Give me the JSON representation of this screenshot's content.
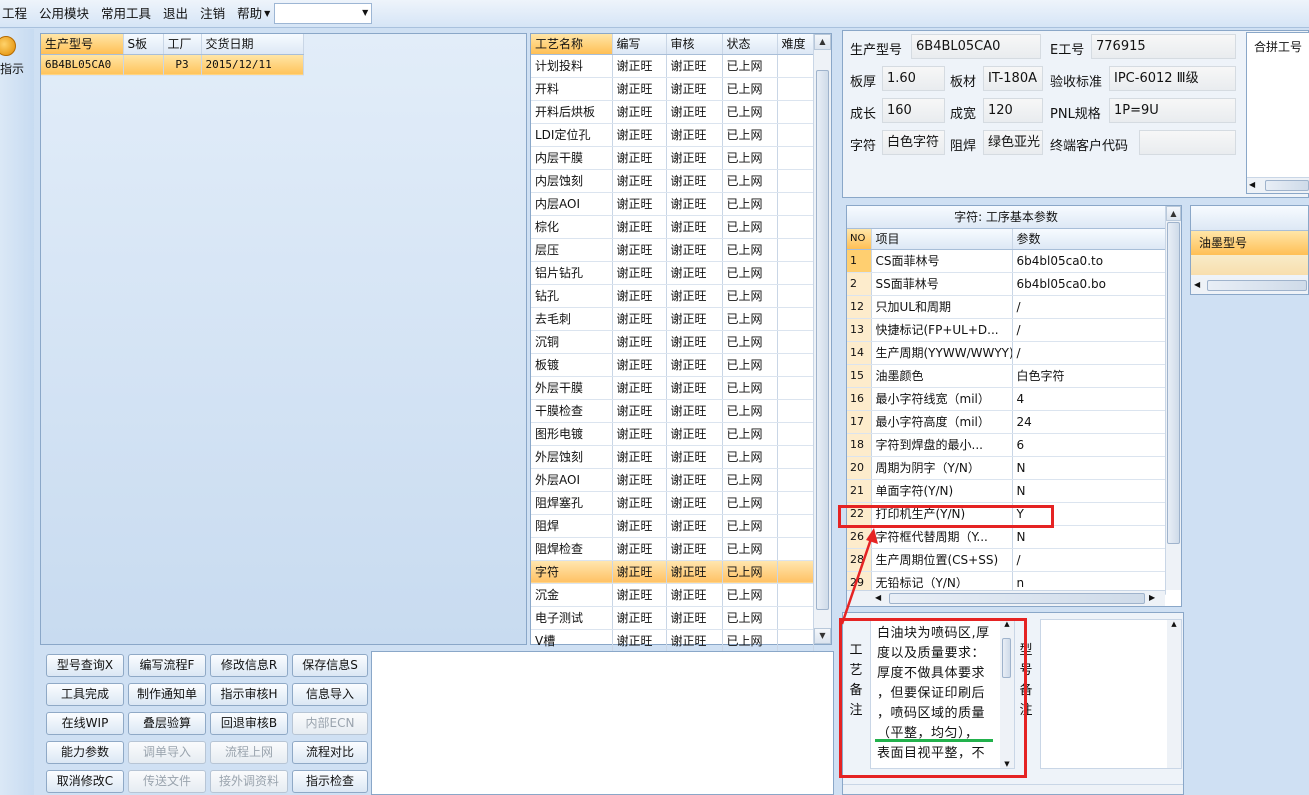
{
  "menu": {
    "items": [
      "工程",
      "公用模块",
      "常用工具",
      "退出",
      "注销",
      "帮助"
    ],
    "combo_value": ""
  },
  "side": {
    "label": "指示"
  },
  "orders": {
    "headers": [
      "生产型号",
      "S板",
      "工厂",
      "交货日期"
    ],
    "rows": [
      [
        "6B4BL05CA0",
        "",
        "P3",
        "2015/12/11"
      ]
    ]
  },
  "process": {
    "headers": [
      "工艺名称",
      "编写",
      "审核",
      "状态",
      "难度"
    ],
    "rows": [
      [
        "计划投料",
        "谢正旺",
        "谢正旺",
        "已上网",
        ""
      ],
      [
        "开料",
        "谢正旺",
        "谢正旺",
        "已上网",
        ""
      ],
      [
        "开料后烘板",
        "谢正旺",
        "谢正旺",
        "已上网",
        ""
      ],
      [
        "LDI定位孔",
        "谢正旺",
        "谢正旺",
        "已上网",
        ""
      ],
      [
        "内层干膜",
        "谢正旺",
        "谢正旺",
        "已上网",
        ""
      ],
      [
        "内层蚀刻",
        "谢正旺",
        "谢正旺",
        "已上网",
        ""
      ],
      [
        "内层AOI",
        "谢正旺",
        "谢正旺",
        "已上网",
        ""
      ],
      [
        "棕化",
        "谢正旺",
        "谢正旺",
        "已上网",
        ""
      ],
      [
        "层压",
        "谢正旺",
        "谢正旺",
        "已上网",
        ""
      ],
      [
        "铝片钻孔",
        "谢正旺",
        "谢正旺",
        "已上网",
        ""
      ],
      [
        "钻孔",
        "谢正旺",
        "谢正旺",
        "已上网",
        ""
      ],
      [
        "去毛刺",
        "谢正旺",
        "谢正旺",
        "已上网",
        ""
      ],
      [
        "沉铜",
        "谢正旺",
        "谢正旺",
        "已上网",
        ""
      ],
      [
        "板镀",
        "谢正旺",
        "谢正旺",
        "已上网",
        ""
      ],
      [
        "外层干膜",
        "谢正旺",
        "谢正旺",
        "已上网",
        ""
      ],
      [
        "干膜检查",
        "谢正旺",
        "谢正旺",
        "已上网",
        ""
      ],
      [
        "图形电镀",
        "谢正旺",
        "谢正旺",
        "已上网",
        ""
      ],
      [
        "外层蚀刻",
        "谢正旺",
        "谢正旺",
        "已上网",
        ""
      ],
      [
        "外层AOI",
        "谢正旺",
        "谢正旺",
        "已上网",
        ""
      ],
      [
        "阻焊塞孔",
        "谢正旺",
        "谢正旺",
        "已上网",
        ""
      ],
      [
        "阻焊",
        "谢正旺",
        "谢正旺",
        "已上网",
        ""
      ],
      [
        "阻焊检查",
        "谢正旺",
        "谢正旺",
        "已上网",
        ""
      ],
      [
        "字符",
        "谢正旺",
        "谢正旺",
        "已上网",
        ""
      ],
      [
        "沉金",
        "谢正旺",
        "谢正旺",
        "已上网",
        ""
      ],
      [
        "电子测试",
        "谢正旺",
        "谢正旺",
        "已上网",
        ""
      ],
      [
        "V槽",
        "谢正旺",
        "谢正旺",
        "已上网",
        ""
      ]
    ],
    "selected_index": 22
  },
  "buttons": [
    [
      "型号查询X",
      "编写流程F",
      "修改信息R",
      "保存信息S"
    ],
    [
      "工具完成",
      "制作通知单",
      "指示审核H",
      "信息导入"
    ],
    [
      "在线WIP",
      "叠层验算",
      "回退审核B",
      "内部ECN"
    ],
    [
      "能力参数",
      "调单导入",
      "流程上网",
      "流程对比"
    ],
    [
      "取消修改C",
      "传送文件",
      "接外调资料",
      "指示检查"
    ]
  ],
  "disabled_buttons": [
    "内部ECN",
    "调单导入",
    "流程上网",
    "传送文件",
    "接外调资料"
  ],
  "info": {
    "labels": {
      "model": "生产型号",
      "e_no": "E工号",
      "thickness": "板厚",
      "material": "板材",
      "standard": "验收标准",
      "length": "成长",
      "width": "成宽",
      "pnl": "PNL规格",
      "char": "字符",
      "mask": "阻焊",
      "customer": "终端客户代码",
      "combo_no": "合拼工号"
    },
    "values": {
      "model": "6B4BL05CA0",
      "e_no": "776915",
      "thickness": "1.60",
      "material": "IT-180A",
      "standard": "IPC-6012 Ⅲ级",
      "length": "160",
      "width": "120",
      "pnl": "1P=9U",
      "char": "白色字符",
      "mask": "绿色亚光",
      "customer": ""
    }
  },
  "params": {
    "title": "字符: 工序基本参数",
    "headers": [
      "NO",
      "项目",
      "参数"
    ],
    "rows": [
      [
        "1",
        "CS面菲林号",
        "6b4bl05ca0.to"
      ],
      [
        "2",
        "SS面菲林号",
        "6b4bl05ca0.bo"
      ],
      [
        "12",
        "只加UL和周期",
        "/"
      ],
      [
        "13",
        "快捷标记(FP+UL+D...",
        "/"
      ],
      [
        "14",
        "生产周期(YYWW/WWYY)",
        "/"
      ],
      [
        "15",
        "油墨颜色",
        "白色字符"
      ],
      [
        "16",
        "最小字符线宽（mil）",
        "4"
      ],
      [
        "17",
        "最小字符高度（mil）",
        "24"
      ],
      [
        "18",
        "字符到焊盘的最小...",
        "6"
      ],
      [
        "20",
        "周期为阴字（Y/N）",
        "N"
      ],
      [
        "21",
        "单面字符(Y/N)",
        "N"
      ],
      [
        "22",
        "打印机生产(Y/N)",
        "Y"
      ],
      [
        "26",
        "字符框代替周期（Y...",
        "N"
      ],
      [
        "28",
        "生产周期位置(CS+SS)",
        "/"
      ],
      [
        "29",
        "无铅标记（Y/N）",
        "n"
      ]
    ]
  },
  "ink": {
    "header": "油墨型号"
  },
  "notes": {
    "process_label_chars": [
      "工",
      "艺",
      "备",
      "注"
    ],
    "model_label_chars": [
      "型",
      "号",
      "备",
      "注"
    ],
    "lines": [
      "白油块为喷码区,厚",
      "度以及质量要求：",
      "厚度不做具体要求",
      "，但要保证印刷后",
      "，喷码区域的质量",
      "（平整，均匀），",
      "表面目视平整，不"
    ]
  },
  "colors": {
    "selection": "#ffc35a",
    "highlight_box": "#e52323",
    "underline": "#22b14c",
    "panel_bg": "#cfe0f3"
  }
}
